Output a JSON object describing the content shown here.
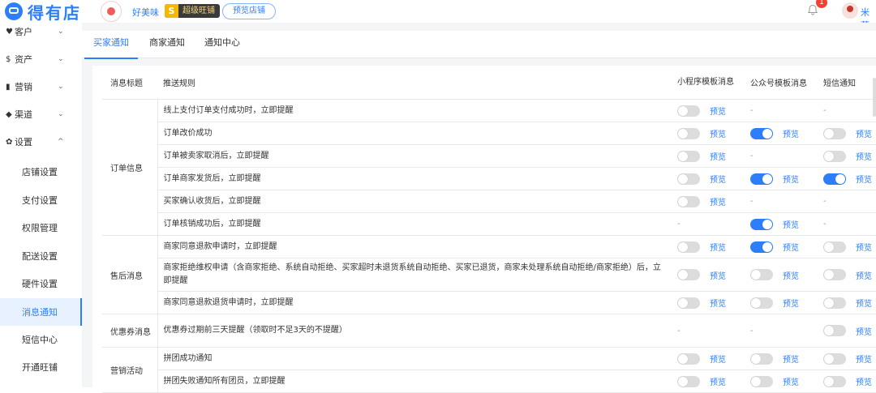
{
  "brand": {
    "name": "得有店",
    "color": "#2d7ff9"
  },
  "shop": {
    "name": "好美味",
    "vip_letter": "S",
    "vip_label": "超级旺铺",
    "preview_button": "预览店铺"
  },
  "user": {
    "notifications": "1",
    "name": "米菲"
  },
  "sidebar": {
    "groups": [
      {
        "icon": "customer-icon",
        "glyph": "♥",
        "label": "客户",
        "arrow": "⌄"
      },
      {
        "icon": "asset-icon",
        "glyph": "$",
        "label": "资产",
        "arrow": "⌄"
      },
      {
        "icon": "marketing-icon",
        "glyph": "▮",
        "label": "营销",
        "arrow": "⌄"
      },
      {
        "icon": "channel-icon",
        "glyph": "◆",
        "label": "渠道",
        "arrow": "⌄"
      },
      {
        "icon": "settings-icon",
        "glyph": "✿",
        "label": "设置",
        "arrow": "^"
      }
    ],
    "sub_items": [
      {
        "label": "店铺设置"
      },
      {
        "label": "支付设置"
      },
      {
        "label": "权限管理"
      },
      {
        "label": "配送设置"
      },
      {
        "label": "硬件设置"
      },
      {
        "label": "消息通知",
        "active": true
      },
      {
        "label": "短信中心"
      },
      {
        "label": "开通旺铺"
      }
    ]
  },
  "tabs": [
    {
      "label": "买家通知",
      "active": true
    },
    {
      "label": "商家通知"
    },
    {
      "label": "通知中心"
    }
  ],
  "table": {
    "headers": {
      "title": "消息标题",
      "rule": "推送规则",
      "mini": "小程序模板消息",
      "mp": "公众号模板消息",
      "sms": "短信通知"
    },
    "preview_label": "预览",
    "dash": "-",
    "groups": [
      {
        "category": "订单信息",
        "rows": [
          {
            "rule": "线上支付订单支付成功时，立即提醒",
            "mini": "off",
            "mp": "none",
            "sms": "none"
          },
          {
            "rule": "订单改价成功",
            "mini": "off",
            "mp": "on",
            "sms": "off"
          },
          {
            "rule": "订单被卖家取消后，立即提醒",
            "mini": "off",
            "mp": "none",
            "sms": "off"
          },
          {
            "rule": "订单商家发货后，立即提醒",
            "mini": "off",
            "mp": "on",
            "sms": "on"
          },
          {
            "rule": "买家确认收货后，立即提醒",
            "mini": "off",
            "mp": "none",
            "sms": "none"
          },
          {
            "rule": "订单核销成功后，立即提醒",
            "mini": "none",
            "mp": "on",
            "sms": "none"
          }
        ]
      },
      {
        "category": "售后消息",
        "rows": [
          {
            "rule": "商家同意退款申请时，立即提醒",
            "mini": "off",
            "mp": "on",
            "sms": "off"
          },
          {
            "rule": "商家拒绝维权申请（含商家拒绝、系统自动拒绝、买家超时未退货系统自动拒绝、买家已退货，商家未处理系统自动拒绝/商家拒绝）后，立即提醒",
            "mini": "off",
            "mp": "off",
            "sms": "off",
            "tall": true
          },
          {
            "rule": "商家同意退款退货申请时，立即提醒",
            "mini": "off",
            "mp": "off",
            "sms": "off"
          }
        ]
      },
      {
        "category": "优惠券消息",
        "rows": [
          {
            "rule": "优惠券过期前三天提醒（领取时不足3天的不提醒）",
            "mini": "none",
            "mp": "none",
            "sms": "off",
            "tall": true
          }
        ]
      },
      {
        "category": "营销活动",
        "rows": [
          {
            "rule": "拼团成功通知",
            "mini": "off",
            "mp": "off",
            "sms": "off"
          },
          {
            "rule": "拼团失败通知所有团员，立即提醒",
            "mini": "off",
            "mp": "off",
            "sms": "off"
          }
        ]
      }
    ]
  }
}
